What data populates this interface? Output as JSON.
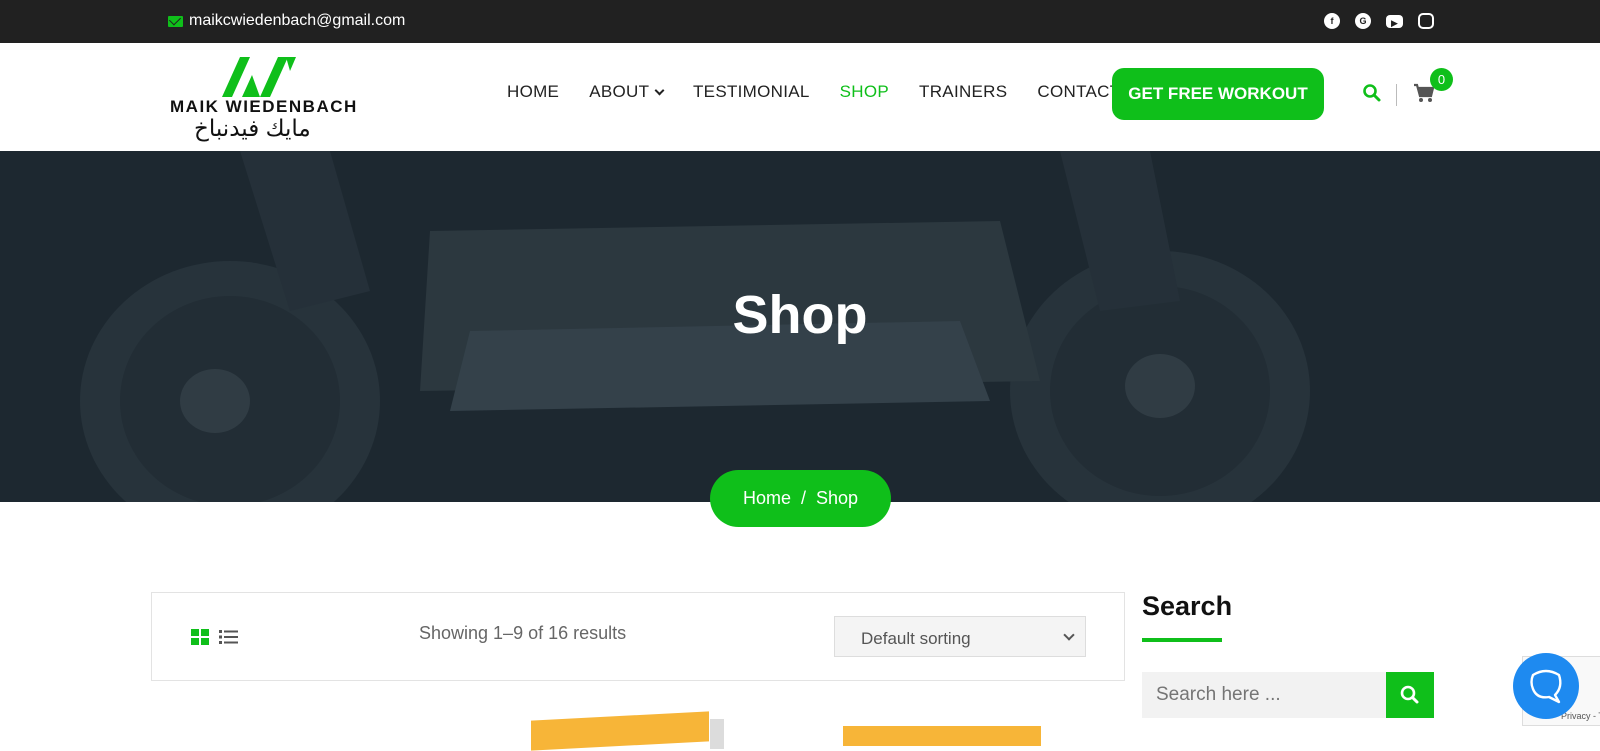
{
  "topbar": {
    "email": "maikcwiedenbach@gmail.com",
    "socials": [
      "facebook-icon",
      "google-plus-icon",
      "youtube-icon",
      "instagram-icon"
    ]
  },
  "logo": {
    "brand": "MAIK WIEDENBACH",
    "arabic": "مايك فيدنباخ"
  },
  "nav": {
    "items": [
      {
        "label": "HOME"
      },
      {
        "label": "ABOUT"
      },
      {
        "label": "TESTIMONIAL"
      },
      {
        "label": "SHOP"
      },
      {
        "label": "TRAINERS"
      },
      {
        "label": "CONTACT"
      }
    ],
    "active": "SHOP",
    "cta": "GET FREE WORKOUT",
    "cart_count": "0"
  },
  "hero": {
    "title": "Shop"
  },
  "breadcrumb": {
    "home": "Home",
    "separator": "/",
    "current": "Shop"
  },
  "toolbar": {
    "results": "Showing 1–9 of 16 results",
    "sort_selected": "Default sorting"
  },
  "sidebar": {
    "search_title": "Search",
    "search_placeholder": "Search here ..."
  },
  "recaptcha": {
    "text": "Privacy - Terms"
  },
  "colors": {
    "accent": "#0fbf1a",
    "topbar_bg": "#212121",
    "hero_bg": "#1d2830",
    "chat_bubble": "#1e8af0"
  }
}
